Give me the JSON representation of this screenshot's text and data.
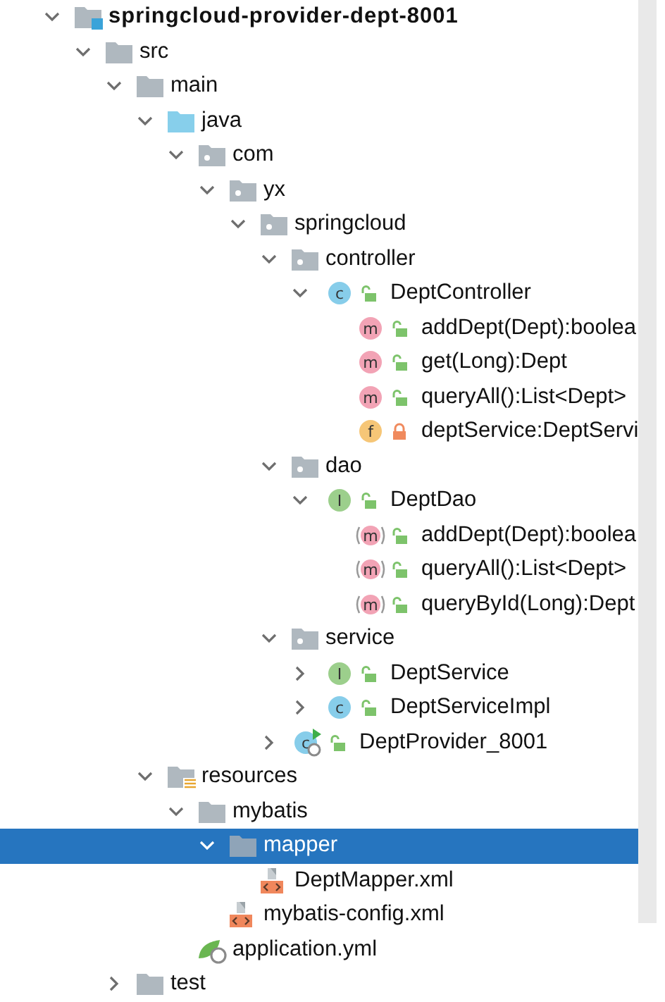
{
  "tree": [
    {
      "label": "springcloud-provider-dept-8001",
      "kind": "module",
      "expanded": true,
      "selected": false,
      "children": [
        {
          "label": "src",
          "kind": "folder",
          "expanded": true,
          "selected": false,
          "children": [
            {
              "label": "main",
              "kind": "folder",
              "expanded": true,
              "selected": false,
              "children": [
                {
                  "label": "java",
                  "kind": "source-folder",
                  "expanded": true,
                  "selected": false,
                  "children": [
                    {
                      "label": "com",
                      "kind": "package",
                      "expanded": true,
                      "selected": false,
                      "children": [
                        {
                          "label": "yx",
                          "kind": "package",
                          "expanded": true,
                          "selected": false,
                          "children": [
                            {
                              "label": "springcloud",
                              "kind": "package",
                              "expanded": true,
                              "selected": false,
                              "children": [
                                {
                                  "label": "controller",
                                  "kind": "package",
                                  "expanded": true,
                                  "selected": false,
                                  "children": [
                                    {
                                      "label": "DeptController",
                                      "kind": "class",
                                      "badge": "c",
                                      "locked": false,
                                      "expanded": true,
                                      "selected": false,
                                      "children": [
                                        {
                                          "label": "addDept(Dept):boolea",
                                          "kind": "method",
                                          "badge": "m",
                                          "locked": false,
                                          "selected": false
                                        },
                                        {
                                          "label": "get(Long):Dept",
                                          "kind": "method",
                                          "badge": "m",
                                          "locked": false,
                                          "selected": false
                                        },
                                        {
                                          "label": "queryAll():List<Dept>",
                                          "kind": "method",
                                          "badge": "m",
                                          "locked": false,
                                          "selected": false
                                        },
                                        {
                                          "label": "deptService:DeptServi",
                                          "kind": "field",
                                          "badge": "f",
                                          "locked": true,
                                          "selected": false
                                        }
                                      ]
                                    }
                                  ]
                                },
                                {
                                  "label": "dao",
                                  "kind": "package",
                                  "expanded": true,
                                  "selected": false,
                                  "children": [
                                    {
                                      "label": "DeptDao",
                                      "kind": "interface",
                                      "badge": "I",
                                      "locked": false,
                                      "expanded": true,
                                      "selected": false,
                                      "children": [
                                        {
                                          "label": "addDept(Dept):boolea",
                                          "kind": "abstract-method",
                                          "badge": "m",
                                          "locked": false,
                                          "selected": false
                                        },
                                        {
                                          "label": "queryAll():List<Dept>",
                                          "kind": "abstract-method",
                                          "badge": "m",
                                          "locked": false,
                                          "selected": false
                                        },
                                        {
                                          "label": "queryById(Long):Dept",
                                          "kind": "abstract-method",
                                          "badge": "m",
                                          "locked": false,
                                          "selected": false
                                        }
                                      ]
                                    }
                                  ]
                                },
                                {
                                  "label": "service",
                                  "kind": "package",
                                  "expanded": true,
                                  "selected": false,
                                  "children": [
                                    {
                                      "label": "DeptService",
                                      "kind": "interface",
                                      "badge": "I",
                                      "locked": false,
                                      "expanded": false,
                                      "selected": false
                                    },
                                    {
                                      "label": "DeptServiceImpl",
                                      "kind": "class",
                                      "badge": "c",
                                      "locked": false,
                                      "expanded": false,
                                      "selected": false
                                    }
                                  ]
                                },
                                {
                                  "label": "DeptProvider_8001",
                                  "kind": "boot-class",
                                  "badge": "c",
                                  "locked": false,
                                  "expanded": false,
                                  "selected": false
                                }
                              ]
                            }
                          ]
                        }
                      ]
                    }
                  ]
                },
                {
                  "label": "resources",
                  "kind": "resources",
                  "expanded": true,
                  "selected": false,
                  "children": [
                    {
                      "label": "mybatis",
                      "kind": "folder",
                      "expanded": true,
                      "selected": false,
                      "children": [
                        {
                          "label": "mapper",
                          "kind": "folder",
                          "expanded": true,
                          "selected": true,
                          "children": [
                            {
                              "label": "DeptMapper.xml",
                              "kind": "xml",
                              "selected": false
                            }
                          ]
                        },
                        {
                          "label": "mybatis-config.xml",
                          "kind": "xml",
                          "selected": false
                        }
                      ]
                    },
                    {
                      "label": "application.yml",
                      "kind": "yml",
                      "selected": false
                    }
                  ]
                }
              ]
            },
            {
              "label": "test",
              "kind": "folder",
              "expanded": false,
              "selected": false
            }
          ]
        }
      ]
    }
  ]
}
